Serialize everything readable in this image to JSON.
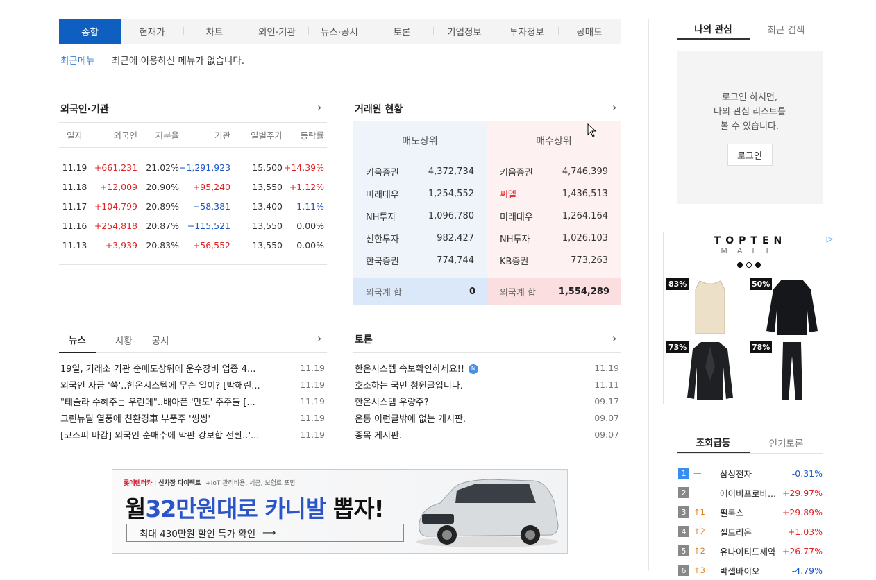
{
  "tabs": [
    "종합",
    "현재가",
    "차트",
    "외인·기관",
    "뉴스·공시",
    "토론",
    "기업정보",
    "투자정보",
    "공매도"
  ],
  "recent": {
    "label": "최근메뉴",
    "text": "최근에 이용하신 메뉴가 없습니다."
  },
  "foreign": {
    "title": "외국인·기관",
    "headers": [
      "일자",
      "외국인",
      "지분율",
      "기관",
      "일별주가",
      "등락률"
    ],
    "rows": [
      {
        "date": "11.19",
        "foreign": "+661,231",
        "share": "21.02%",
        "inst": "−1,291,923",
        "price": "15,500",
        "rate": "+14.39%",
        "f": "red",
        "i": "blue",
        "r": "red"
      },
      {
        "date": "11.18",
        "foreign": "+12,009",
        "share": "20.90%",
        "inst": "+95,240",
        "price": "13,550",
        "rate": "+1.12%",
        "f": "red",
        "i": "red",
        "r": "red"
      },
      {
        "date": "11.17",
        "foreign": "+104,799",
        "share": "20.89%",
        "inst": "−58,381",
        "price": "13,400",
        "rate": "-1.11%",
        "f": "red",
        "i": "blue",
        "r": "blue"
      },
      {
        "date": "11.16",
        "foreign": "+254,818",
        "share": "20.87%",
        "inst": "−115,521",
        "price": "13,550",
        "rate": "0.00%",
        "f": "red",
        "i": "blue",
        "r": ""
      },
      {
        "date": "11.13",
        "foreign": "+3,939",
        "share": "20.83%",
        "inst": "+56,552",
        "price": "13,550",
        "rate": "0.00%",
        "f": "red",
        "i": "red",
        "r": ""
      }
    ]
  },
  "broker": {
    "title": "거래원 현황",
    "sell": {
      "head": "매도상위",
      "rows": [
        [
          "키움증권",
          "4,372,734"
        ],
        [
          "미래대우",
          "1,254,552"
        ],
        [
          "NH투자",
          "1,096,780"
        ],
        [
          "신한투자",
          "982,427"
        ],
        [
          "한국증권",
          "774,744"
        ]
      ],
      "foot_label": "외국계 합",
      "foot_value": "0"
    },
    "buy": {
      "head": "매수상위",
      "rows": [
        [
          "키움증권",
          "4,746,399"
        ],
        [
          "씨엘",
          "1,436,513"
        ],
        [
          "미래대우",
          "1,264,164"
        ],
        [
          "NH투자",
          "1,026,103"
        ],
        [
          "KB증권",
          "773,263"
        ]
      ],
      "foot_label": "외국계 합",
      "foot_value": "1,554,289"
    }
  },
  "news": {
    "tabs": [
      "뉴스",
      "시황",
      "공시"
    ],
    "items": [
      {
        "t": "19일, 거래소 기관 순매도상위에 운수장비 업종 4...",
        "d": "11.19"
      },
      {
        "t": "외국인 자금 '쑥'..한온시스템에 무슨 일이? [박해린...",
        "d": "11.19"
      },
      {
        "t": "\"테슬라 수혜주는 우린데\"..배아픈 '만도' 주주들 [...",
        "d": "11.19"
      },
      {
        "t": "그린뉴딜 열풍에 친환경車 부품주 '씽씽'",
        "d": "11.19"
      },
      {
        "t": "[코스피 마감] 외국인 순매수에 막판 강보합 전환..'...",
        "d": "11.19"
      }
    ]
  },
  "board": {
    "title": "토론",
    "items": [
      {
        "t": "한온시스템 속보확인하세요!!",
        "d": "11.19",
        "badge": "N"
      },
      {
        "t": "호소하는 국민 청원글입니다.",
        "d": "11.11"
      },
      {
        "t": "한온시스템 우량주?",
        "d": "09.17"
      },
      {
        "t": "온통 이런글밖에 없는 게시판.",
        "d": "09.07"
      },
      {
        "t": "종목 게시판.",
        "d": "09.07"
      }
    ]
  },
  "mywatch": {
    "tabs": [
      "나의 관심",
      "최근 검색"
    ],
    "msg1": "로그인 하시면,",
    "msg2": "나의 관심 리스트를",
    "msg3": "볼 수 있습니다.",
    "button": "로그인"
  },
  "ad": {
    "brand1": "TOPTEN",
    "brand2": "MALL",
    "items": [
      "83%",
      "50%",
      "73%",
      "78%"
    ]
  },
  "rank": {
    "tabs": [
      "조회급등",
      "인기토론"
    ],
    "rows": [
      {
        "n": "1",
        "chg": "—",
        "up": false,
        "name": "삼성전자",
        "pct": "-0.31%",
        "c": "blue"
      },
      {
        "n": "2",
        "chg": "—",
        "up": false,
        "name": "에이비프로바...",
        "pct": "+29.97%",
        "c": "red"
      },
      {
        "n": "3",
        "chg": "1",
        "up": true,
        "name": "필룩스",
        "pct": "+29.89%",
        "c": "red"
      },
      {
        "n": "4",
        "chg": "2",
        "up": true,
        "name": "셀트리온",
        "pct": "+1.03%",
        "c": "red"
      },
      {
        "n": "5",
        "chg": "2",
        "up": true,
        "name": "유나이티드제약",
        "pct": "+26.77%",
        "c": "red"
      },
      {
        "n": "6",
        "chg": "3",
        "up": true,
        "name": "박셀바이오",
        "pct": "-4.79%",
        "c": "blue"
      }
    ]
  },
  "banner": {
    "top_brand": "롯데렌터카",
    "top_mid": "신차장 다이렉트",
    "top_note": "+IoT 관리비용, 세금, 보험료 포함",
    "head1": "월",
    "head2": "32만원대로",
    "head3": "카니발",
    "head4": "뽑자!",
    "cta": "최대 430만원 할인 특가 확인"
  }
}
